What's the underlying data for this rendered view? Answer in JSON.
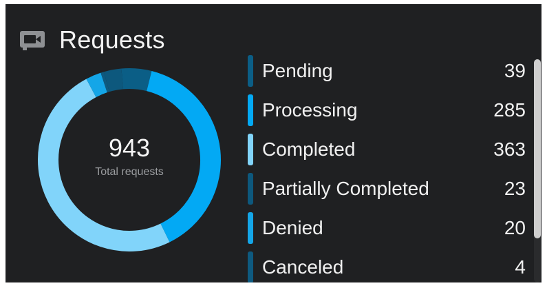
{
  "header": {
    "title": "Requests",
    "icon": "video-camera-icon"
  },
  "summary": {
    "total": "943",
    "caption": "Total requests"
  },
  "colors": {
    "card_background": "#1f2022",
    "pending": "#0b5e86",
    "processing": "#03a9f4",
    "completed": "#81d4fa",
    "partially_completed": "#0d587d",
    "denied": "#14a6e8",
    "canceled": "#0e5a80"
  },
  "statuses": [
    {
      "key": "pending",
      "label": "Pending",
      "count": "39",
      "value": 39,
      "color": "#0b5e86"
    },
    {
      "key": "processing",
      "label": "Processing",
      "count": "285",
      "value": 285,
      "color": "#03a9f4"
    },
    {
      "key": "completed",
      "label": "Completed",
      "count": "363",
      "value": 363,
      "color": "#81d4fa"
    },
    {
      "key": "partially_completed",
      "label": "Partially Completed",
      "count": "23",
      "value": 23,
      "color": "#0d587d"
    },
    {
      "key": "denied",
      "label": "Denied",
      "count": "20",
      "value": 20,
      "color": "#14a6e8"
    },
    {
      "key": "canceled",
      "label": "Canceled",
      "count": "4",
      "value": 4,
      "color": "#0e5a80"
    }
  ]
}
